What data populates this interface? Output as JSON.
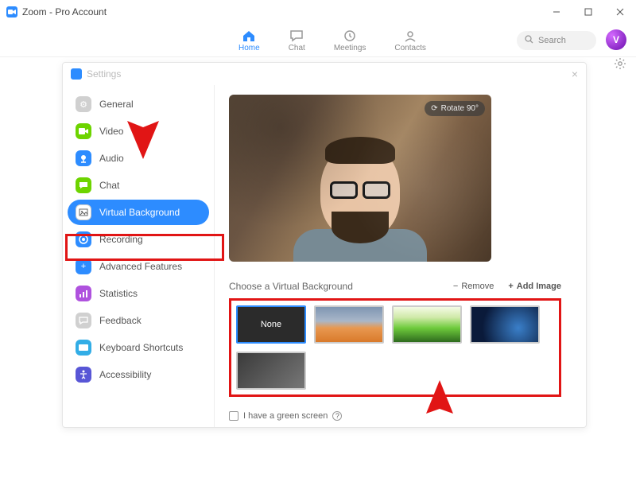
{
  "titlebar": {
    "app_title": "Zoom - Pro Account"
  },
  "toolbar": {
    "tabs": [
      {
        "label": "Home",
        "active": true
      },
      {
        "label": "Chat",
        "active": false
      },
      {
        "label": "Meetings",
        "active": false
      },
      {
        "label": "Contacts",
        "active": false
      }
    ],
    "search_placeholder": "Search",
    "avatar_initial": "V"
  },
  "settings": {
    "window_title": "Settings",
    "items": [
      {
        "label": "General",
        "icon": "gear-icon",
        "color": "c-gray"
      },
      {
        "label": "Video",
        "icon": "video-icon",
        "color": "c-green"
      },
      {
        "label": "Audio",
        "icon": "audio-icon",
        "color": "c-blue"
      },
      {
        "label": "Chat",
        "icon": "chat-icon",
        "color": "c-green"
      },
      {
        "label": "Virtual Background",
        "icon": "image-icon",
        "color": "c-white",
        "active": true
      },
      {
        "label": "Recording",
        "icon": "record-icon",
        "color": "c-blue"
      },
      {
        "label": "Advanced Features",
        "icon": "plus-icon",
        "color": "c-blue"
      },
      {
        "label": "Statistics",
        "icon": "stats-icon",
        "color": "c-purple"
      },
      {
        "label": "Feedback",
        "icon": "feedback-icon",
        "color": "c-gray"
      },
      {
        "label": "Keyboard Shortcuts",
        "icon": "keyboard-icon",
        "color": "c-teal"
      },
      {
        "label": "Accessibility",
        "icon": "accessibility-icon",
        "color": "c-indigo"
      }
    ]
  },
  "content": {
    "rotate_label": "Rotate 90°",
    "section_label": "Choose a Virtual Background",
    "remove_label": "Remove",
    "add_label": "Add Image",
    "thumbnails": [
      {
        "label": "None",
        "selected": true
      },
      {
        "label": "",
        "class": "t1"
      },
      {
        "label": "",
        "class": "t2"
      },
      {
        "label": "",
        "class": "t3"
      },
      {
        "label": "",
        "class": "t4"
      }
    ],
    "green_screen_label": "I have a green screen"
  }
}
